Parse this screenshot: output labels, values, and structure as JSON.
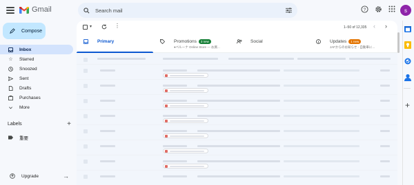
{
  "app": {
    "name": "Gmail"
  },
  "search": {
    "placeholder": "Search mail"
  },
  "account": {
    "avatar_letter": "s"
  },
  "compose": {
    "label": "Compose"
  },
  "sidebar": {
    "items": [
      {
        "label": "Inbox",
        "icon": "inbox-icon",
        "active": true
      },
      {
        "label": "Starred",
        "icon": "star-icon"
      },
      {
        "label": "Snoozed",
        "icon": "clock-icon"
      },
      {
        "label": "Sent",
        "icon": "send-icon"
      },
      {
        "label": "Drafts",
        "icon": "draft-icon"
      },
      {
        "label": "Purchases",
        "icon": "purchases-icon"
      },
      {
        "label": "More",
        "icon": "chevron-down-icon"
      }
    ],
    "labels_title": "Labels",
    "labels": [
      {
        "label": "重要"
      }
    ],
    "upgrade": "Upgrade"
  },
  "toolbar": {
    "pagination": "1–50 of 12,335"
  },
  "tabs": [
    {
      "label": "Primary",
      "icon": "inbox-icon",
      "active": true,
      "badge": "",
      "sub": ""
    },
    {
      "label": "Promotions",
      "icon": "tag-icon",
      "badge": "3 new",
      "badge_color": "#188038",
      "sub": "●ベルーナ Online Store — お買..."
    },
    {
      "label": "Social",
      "icon": "people-icon",
      "badge": "",
      "sub": ""
    },
    {
      "label": "Updates",
      "icon": "info-icon",
      "badge": "1 new",
      "badge_color": "#e37400",
      "sub": "JAFからのお知らせ - 自動車に..."
    }
  ],
  "colors": {
    "accent": "#0b57d0",
    "compose_bg": "#c2e7ff",
    "active_nav": "#d3e3fd",
    "avatar": "#8e24aa"
  }
}
